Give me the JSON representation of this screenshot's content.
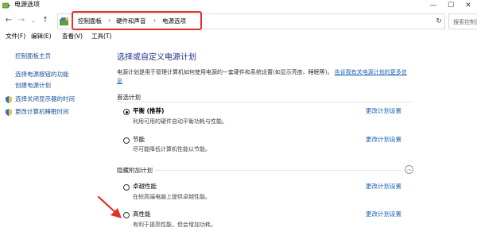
{
  "window": {
    "title": "电源选项",
    "controls": {
      "minimize": "—",
      "maximize": "☐",
      "close": "✕"
    }
  },
  "nav": {
    "back": "←",
    "forward": "→",
    "dropdown": "⌄",
    "up": "↑",
    "refresh": "↻"
  },
  "breadcrumb": [
    "控制面板",
    "硬件和声音",
    "电源选项"
  ],
  "breadcrumb_separator": "›",
  "search": {
    "placeholder": "搜索控制面"
  },
  "menubar": [
    "文件(F)",
    "编辑(E)",
    "查看(V)",
    "工具(T)"
  ],
  "sidebar": {
    "home": "控制面板主页",
    "links": [
      "选择电源按钮的功能",
      "创建电源计划",
      "选择关闭显示器的时间",
      "更改计算机睡眠时间"
    ]
  },
  "main": {
    "heading": "选择或自定义电源计划",
    "description": "电源计划是用于管理计算机如何使用电源的一套硬件和系统设置(如显示亮度、睡眠等)。",
    "description_link": "告诉我有关电源计划的更多信息",
    "preferred_header": "首选计划",
    "hidden_header": "隐藏附加计划",
    "change_label": "更改计划设置",
    "plans": [
      {
        "name": "平衡 (推荐)",
        "desc": "利用可用的硬件自动平衡功耗与性能。",
        "selected": true
      },
      {
        "name": "节能",
        "desc": "尽可能降低计算机性能以节能。",
        "selected": false
      },
      {
        "name": "卓越性能",
        "desc": "在较高端电脑上提供卓越性能。",
        "selected": false
      },
      {
        "name": "高性能",
        "desc": "有利于提高性能，但会增加功耗。",
        "selected": false
      }
    ]
  },
  "colors": {
    "annotation_red": "#e0322a",
    "link_blue": "#1b62b6",
    "heading_blue": "#1e3287"
  },
  "icons": [
    "power-options-icon",
    "back-arrow-icon",
    "forward-arrow-icon",
    "up-arrow-icon",
    "control-panel-folder-icon",
    "refresh-icon",
    "shield-icon",
    "collapse-chevron-icon",
    "annotation-arrow-icon"
  ]
}
